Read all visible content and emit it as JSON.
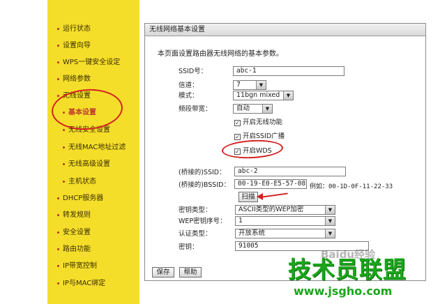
{
  "sidebar": {
    "items": [
      {
        "label": "运行状态"
      },
      {
        "label": "设置向导"
      },
      {
        "label": "WPS一键安全设定"
      },
      {
        "label": "网络参数"
      },
      {
        "label": "无线设置"
      },
      {
        "label": "基本设置"
      },
      {
        "label": "无线安全设置"
      },
      {
        "label": "无线MAC地址过滤"
      },
      {
        "label": "无线高级设置"
      },
      {
        "label": "主机状态"
      },
      {
        "label": "DHCP服务器"
      },
      {
        "label": "转发规则"
      },
      {
        "label": "安全设置"
      },
      {
        "label": "路由功能"
      },
      {
        "label": "IP带宽控制"
      },
      {
        "label": "IP与MAC绑定"
      }
    ]
  },
  "panel": {
    "title": "无线网络基本设置",
    "description": "本页面设置路由器无线网络的基本参数。"
  },
  "form": {
    "ssid_label": "SSID号：",
    "ssid_value": "abc-1",
    "channel_label": "信道：",
    "channel_value": "7",
    "mode_label": "模式：",
    "mode_value": "11bgn mixed",
    "bandwidth_label": "频段带宽：",
    "bandwidth_value": "自动",
    "enable_wireless": "开启无线功能",
    "enable_ssid_broadcast": "开启SSID广播",
    "enable_wds": "开启WDS",
    "bridged_ssid_label": "(桥接的)SSID：",
    "bridged_ssid_value": "abc-2",
    "bridged_bssid_label": "(桥接的)BSSID：",
    "bridged_bssid_value": "00-19-E0-E5-57-08",
    "bssid_example": "例如：00-1D-0F-11-22-33",
    "scan_button": "扫描",
    "key_type_label": "密钥类型：",
    "key_type_value": "ASCII类型的WEP加密",
    "wep_index_label": "WEP密钥序号：",
    "wep_index_value": "1",
    "auth_type_label": "认证类型：",
    "auth_type_value": "开放系统",
    "key_label": "密钥：",
    "key_value": "91005"
  },
  "footer": {
    "save_button": "保存",
    "help_button": "帮助"
  },
  "watermark": {
    "baidu": "Baidu经验",
    "brand": "技术员联盟",
    "url": "www.jsgho.com"
  },
  "colors": {
    "sidebar_bg": "#f5de2a",
    "annotation_red": "#d42020",
    "brand_green": "#1aa51a"
  }
}
